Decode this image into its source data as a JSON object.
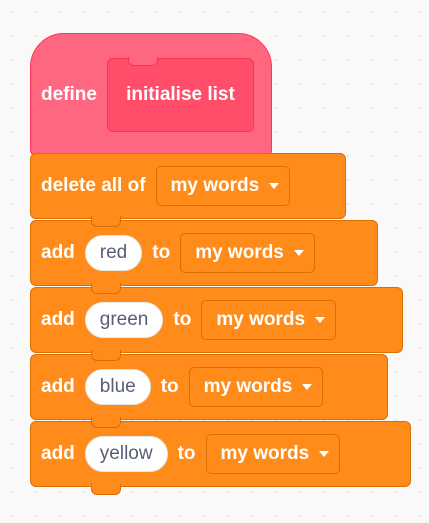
{
  "define_block": {
    "keyword": "define",
    "name": "initialise list"
  },
  "delete_block": {
    "label": "delete all of",
    "list": "my words"
  },
  "add_blocks": [
    {
      "keyword": "add",
      "value": "red",
      "to": "to",
      "list": "my words"
    },
    {
      "keyword": "add",
      "value": "green",
      "to": "to",
      "list": "my words"
    },
    {
      "keyword": "add",
      "value": "blue",
      "to": "to",
      "list": "my words"
    },
    {
      "keyword": "add",
      "value": "yellow",
      "to": "to",
      "list": "my words"
    }
  ],
  "colors": {
    "define": "#ff6680",
    "define_inner": "#ff4d6a",
    "list_block": "#ff8c1a",
    "list_border": "#db6e00",
    "input_bg": "#ffffff",
    "input_text": "#575e75"
  },
  "icons": {
    "dropdown": "dropdown-arrow-icon"
  }
}
